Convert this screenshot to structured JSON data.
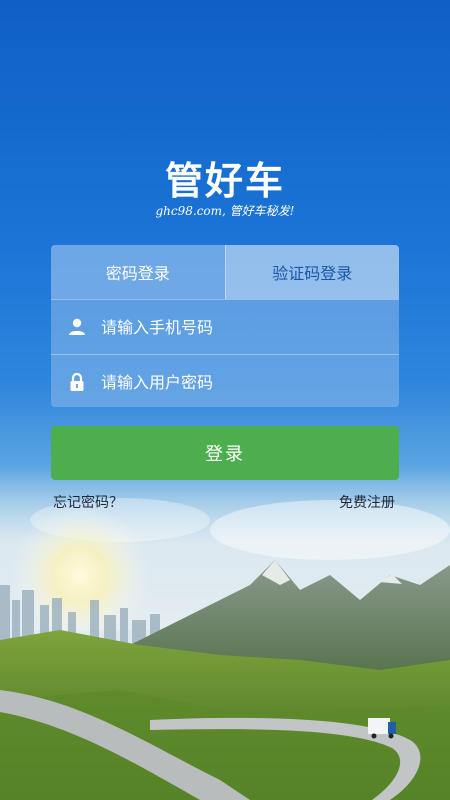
{
  "brand": {
    "logo_text": "管好车",
    "slogan": "ghc98.com, 管好车秘发!"
  },
  "login": {
    "tabs": [
      {
        "label": "密码登录",
        "active": true
      },
      {
        "label": "验证码登录",
        "active": false
      }
    ],
    "phone_placeholder": "请输入手机号码",
    "password_placeholder": "请输入用户密码",
    "submit_label": "登录",
    "forgot_label": "忘记密码？",
    "register_label": "免费注册"
  },
  "icons": {
    "phone": "user-icon",
    "password": "lock-icon"
  },
  "colors": {
    "primary": "#1b74d6",
    "button": "#4cae4f",
    "text_light": "#ffffff"
  }
}
